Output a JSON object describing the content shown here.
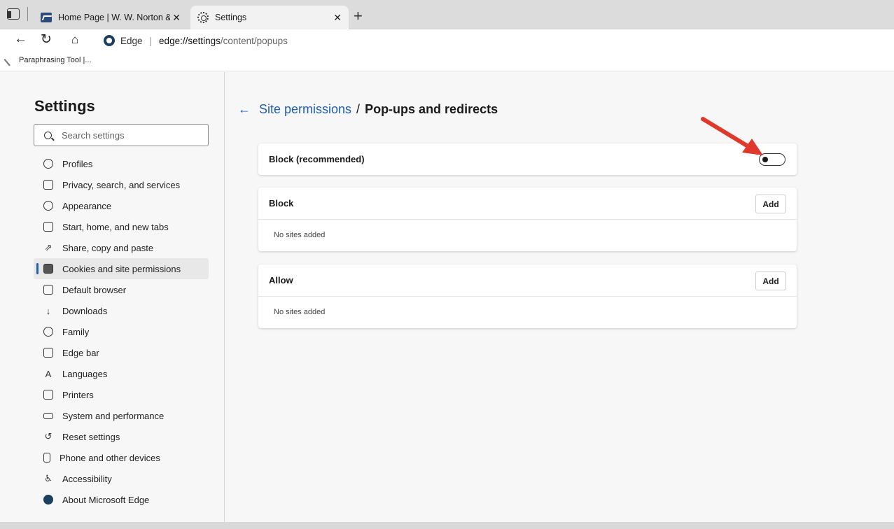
{
  "tabs": [
    {
      "label": "Home Page | W. W. Norton & Co",
      "active": false
    },
    {
      "label": "Settings",
      "active": true
    }
  ],
  "address": {
    "site": "Edge",
    "url_host": "edge://settings",
    "url_path": "/content/popups"
  },
  "favorites": [
    {
      "label": "Paraphrasing Tool |..."
    }
  ],
  "sidebar": {
    "title": "Settings",
    "search_placeholder": "Search settings",
    "items": [
      {
        "label": "Profiles",
        "icon": "profile-icon"
      },
      {
        "label": "Privacy, search, and services",
        "icon": "lock-icon"
      },
      {
        "label": "Appearance",
        "icon": "appearance-icon"
      },
      {
        "label": "Start, home, and new tabs",
        "icon": "start-icon"
      },
      {
        "label": "Share, copy and paste",
        "icon": "share-icon"
      },
      {
        "label": "Cookies and site permissions",
        "icon": "cookies-icon",
        "active": true
      },
      {
        "label": "Default browser",
        "icon": "default-browser-icon"
      },
      {
        "label": "Downloads",
        "icon": "download-icon"
      },
      {
        "label": "Family",
        "icon": "family-icon"
      },
      {
        "label": "Edge bar",
        "icon": "edge-bar-icon"
      },
      {
        "label": "Languages",
        "icon": "languages-icon"
      },
      {
        "label": "Printers",
        "icon": "printer-icon"
      },
      {
        "label": "System and performance",
        "icon": "system-icon"
      },
      {
        "label": "Reset settings",
        "icon": "reset-icon"
      },
      {
        "label": "Phone and other devices",
        "icon": "phone-icon"
      },
      {
        "label": "Accessibility",
        "icon": "accessibility-icon"
      },
      {
        "label": "About Microsoft Edge",
        "icon": "edge-logo-icon"
      }
    ]
  },
  "main": {
    "breadcrumb_link": "Site permissions",
    "breadcrumb_separator": "/",
    "breadcrumb_current": "Pop-ups and redirects",
    "block_recommended_label": "Block (recommended)",
    "block_recommended_enabled": false,
    "block_section": {
      "title": "Block",
      "add_label": "Add",
      "empty_text": "No sites added"
    },
    "allow_section": {
      "title": "Allow",
      "add_label": "Add",
      "empty_text": "No sites added"
    }
  },
  "colors": {
    "accent": "#1f5fae",
    "annotation_arrow": "#e0392b"
  }
}
